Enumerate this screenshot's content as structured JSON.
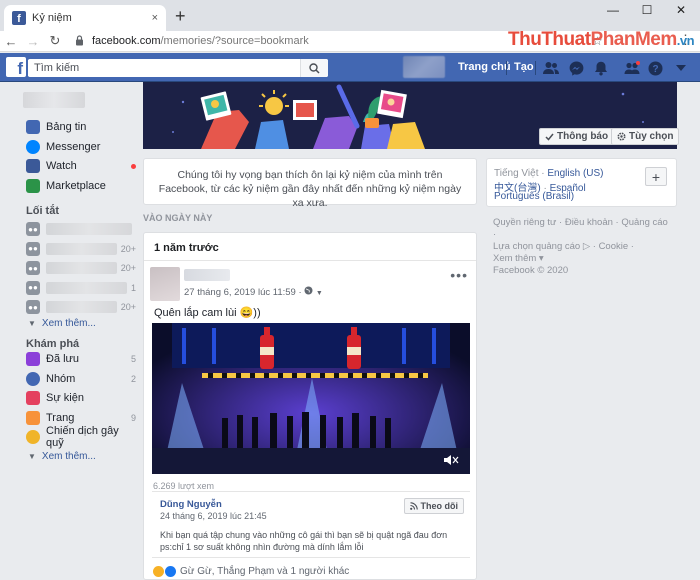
{
  "browser": {
    "tab_title": "Kỷ niệm",
    "tab_close": "×",
    "new_tab": "+",
    "url_host": "facebook.com",
    "url_path": "/memories/?source=bookmark",
    "min": "—",
    "max": "☐",
    "close": "✕"
  },
  "watermark": {
    "part1": "ThuThuat",
    "part2": "PhanMem",
    "part3": ".vn"
  },
  "fb": {
    "logo": "f",
    "search_placeholder": "Tìm kiếm",
    "nav_home": "Trang chủ",
    "nav_create": "Tạo"
  },
  "sidebar": {
    "main": [
      {
        "label": "Bảng tin",
        "icon": "news-feed-icon",
        "color": "#4267b2"
      },
      {
        "label": "Messenger",
        "icon": "messenger-icon",
        "color": "#0084ff"
      },
      {
        "label": "Watch",
        "icon": "watch-icon",
        "color": "#3b5998"
      },
      {
        "label": "Marketplace",
        "icon": "marketplace-icon",
        "color": "#2b9348"
      }
    ],
    "shortcuts_title": "Lối tắt",
    "shortcuts": [
      {
        "count": ""
      },
      {
        "count": "20+"
      },
      {
        "count": "20+"
      },
      {
        "count": "1"
      },
      {
        "count": "20+"
      }
    ],
    "see_more_1": "Xem thêm...",
    "explore_title": "Khám phá",
    "explore": [
      {
        "label": "Đã lưu",
        "count": "5",
        "icon": "saved-icon",
        "color": "#8b3fd9"
      },
      {
        "label": "Nhóm",
        "count": "2",
        "icon": "groups-icon",
        "color": "#4267b2"
      },
      {
        "label": "Sự kiện",
        "count": "",
        "icon": "events-icon",
        "color": "#e4405f"
      },
      {
        "label": "Trang",
        "count": "9",
        "icon": "pages-icon",
        "color": "#f7923a"
      },
      {
        "label": "Chiến dịch gây quỹ",
        "count": "",
        "icon": "fundraiser-icon",
        "color": "#f0b429"
      }
    ],
    "see_more_2": "Xem thêm..."
  },
  "banner": {
    "notify": "Thông báo",
    "customize": "Tùy chọn"
  },
  "intro_text": "Chúng tôi hy vọng bạn thích ôn lại kỷ niệm của mình trên Facebook, từ các kỷ niệm gần đây nhất đến những kỷ niệm ngày xa xưa.",
  "section_label": "VÀO NGÀY NÀY",
  "card": {
    "header": "1 năm trước",
    "post_date": "27 tháng 6, 2019 lúc 11:59 · ",
    "more": "•••",
    "post_text": "Quên lắp cam lùi 😄))",
    "views": "6.269 lượt xem",
    "share_name": "Dũng Nguyễn",
    "share_date": "24 tháng 6, 2019 lúc 21:45",
    "share_line1": "Khi bạn quá tập chung vào những cô gái thì bạn sẽ bị quật ngã đau đơn",
    "share_line2": "ps:chỉ 1 sơ suất không nhìn đường mà dính lắm lỗi",
    "follow": "Theo dõi",
    "reactions": "Gừ Gừ, Thắng Phạm và 1 người khác"
  },
  "languages": {
    "current": "Tiếng Việt",
    "sep": " · ",
    "english": "English (US)",
    "chinese": "中文(台灣)",
    "spanish": "Español",
    "portuguese": "Português (Brasil)",
    "plus": "+"
  },
  "footer": {
    "line1": "Quyền riêng tư · Điều khoản · Quảng cáo ·",
    "line2": "Lựa chọn quảng cáo ▷ · Cookie ·",
    "line3": "Xem thêm ▾",
    "line4": "Facebook © 2020"
  }
}
